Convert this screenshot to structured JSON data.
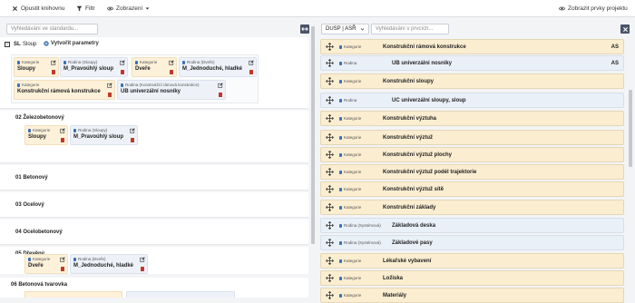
{
  "toolbar": {
    "close_label": "Opustit knihovnu",
    "filter_label": "Filtr",
    "view_label": "Zobrazení",
    "show_project_label": "Zobrazit prvky projektu"
  },
  "left": {
    "search_placeholder": "Vyhledávání ve standardu...",
    "sections": [
      {
        "code": "SL",
        "title": "Sloup",
        "create_label": "Vytvořit parametry"
      },
      {
        "title": "02 Železobetonový"
      },
      {
        "title": "01 Betonový"
      },
      {
        "title": "03 Ocelový"
      },
      {
        "title": "04 Ocelobetonový"
      },
      {
        "title": "05 Dřevěný"
      },
      {
        "title": "06 Betonová tvarovka"
      }
    ],
    "cards": [
      {
        "label": "Kategorie",
        "value": "Sloupy"
      },
      {
        "label": "Rodina (Sloupy)",
        "value": "M_Pravoúhlý sloup"
      },
      {
        "label": "Kategorie",
        "value": "Dveře"
      },
      {
        "label": "Rodina (Dveře)",
        "value": "M_Jednoduché, hladké"
      },
      {
        "label": "Kategorie",
        "value": "Konstrukční rámová konstrukce"
      },
      {
        "label": "Rodina (Konstrukční rámová konstrukce)",
        "value": "UB univerzální nosníky"
      },
      {
        "label": "Kategorie",
        "value": "Sloupy"
      },
      {
        "label": "Rodina (Sloupy)",
        "value": "M_Pravoúhlý sloup"
      },
      {
        "label": "Kategorie",
        "value": "Dveře"
      },
      {
        "label": "Rodina (Dveře)",
        "value": "M_Jednoduché, hladké"
      }
    ]
  },
  "right": {
    "dropdown_value": "DUSP | ASŘ",
    "search_placeholder": "Vyhledávání v prvcích...",
    "rows": [
      {
        "type": "kat",
        "tag": "Kategorie",
        "name": "Konstrukční rámová konstrukce",
        "suffix": "AS"
      },
      {
        "type": "rod",
        "tag": "Rodina",
        "name": "UB univerzální nosníky",
        "suffix": "AS"
      },
      {
        "type": "kat",
        "tag": "Kategorie",
        "name": "Konstrukční sloupy",
        "suffix": ""
      },
      {
        "type": "rod",
        "tag": "Rodina",
        "name": "UC univerzální sloupy, sloup",
        "suffix": ""
      },
      {
        "type": "kat",
        "tag": "Kategorie",
        "name": "Konstrukční výztuha",
        "suffix": ""
      },
      {
        "type": "kat",
        "tag": "Kategorie",
        "name": "Konstrukční výztuž",
        "suffix": ""
      },
      {
        "type": "kat",
        "tag": "Kategorie",
        "name": "Konstrukční výztuž plochy",
        "suffix": ""
      },
      {
        "type": "kat",
        "tag": "Kategorie",
        "name": "Konstrukční výztuž podél trajektorie",
        "suffix": ""
      },
      {
        "type": "kat",
        "tag": "Kategorie",
        "name": "Konstrukční výztuž sítě",
        "suffix": ""
      },
      {
        "type": "kat",
        "tag": "Kategorie",
        "name": "Konstrukční základy",
        "suffix": ""
      },
      {
        "type": "rod",
        "tag": "Rodina (Systémová)",
        "name": "Základová deska",
        "suffix": ""
      },
      {
        "type": "rod",
        "tag": "Rodina (Systémová)",
        "name": "Základové pasy",
        "suffix": ""
      },
      {
        "type": "kat",
        "tag": "Kategorie",
        "name": "Lékařské vybavení",
        "suffix": ""
      },
      {
        "type": "kat",
        "tag": "Kategorie",
        "name": "Ložiska",
        "suffix": ""
      },
      {
        "type": "kat",
        "tag": "Kategorie",
        "name": "Materiály",
        "suffix": ""
      }
    ]
  }
}
